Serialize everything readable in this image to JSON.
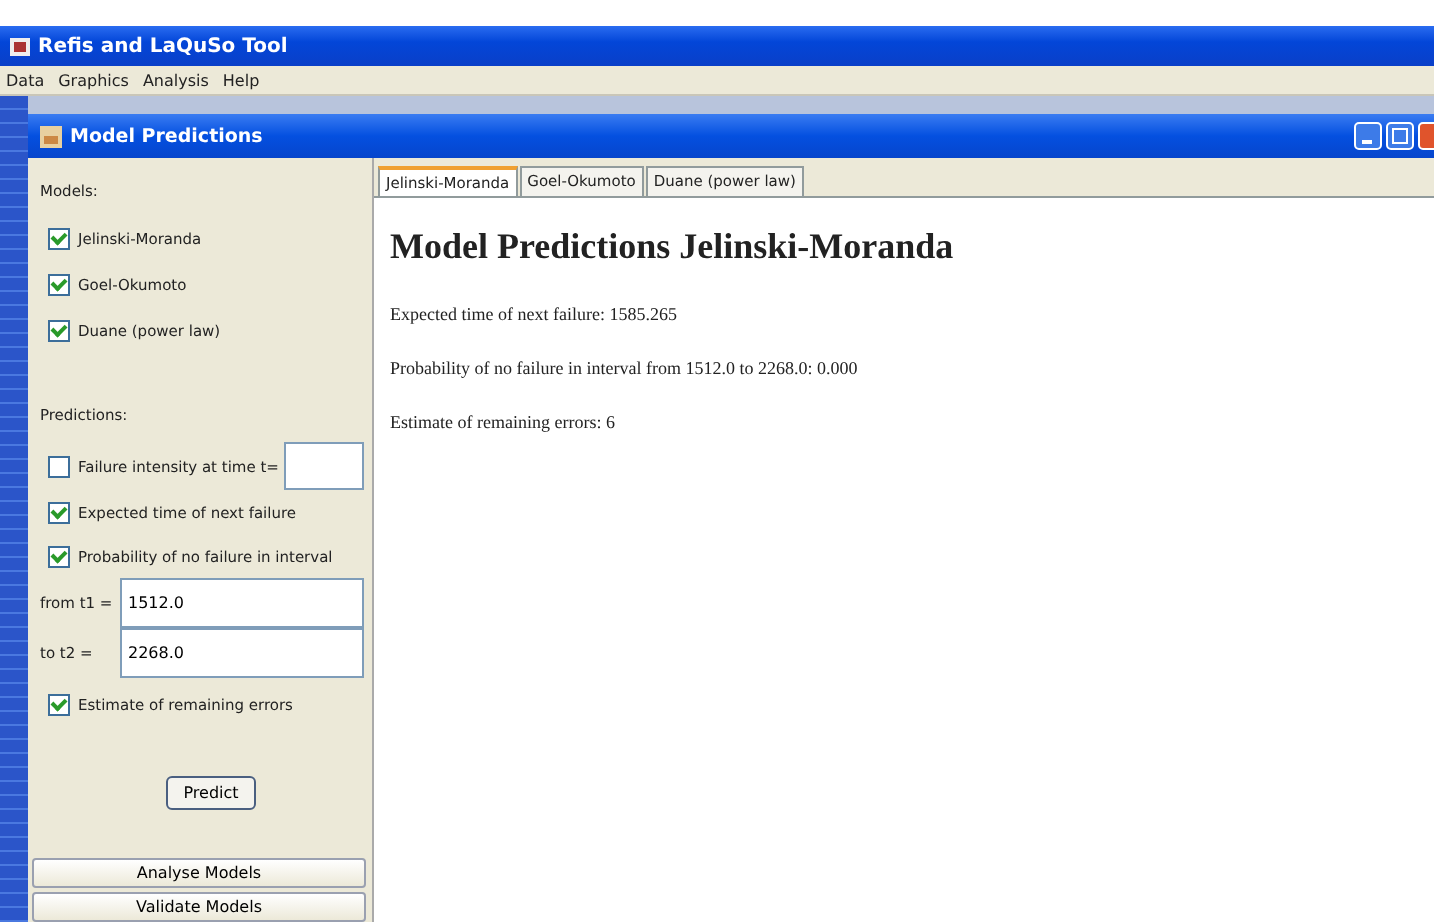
{
  "app_window": {
    "title": "Refis and LaQuSo Tool"
  },
  "menu": [
    "Data",
    "Graphics",
    "Analysis",
    "Help"
  ],
  "dialog": {
    "title": "Model Predictions"
  },
  "models": {
    "label": "Models:",
    "items": [
      {
        "label": "Jelinski-Moranda",
        "checked": true
      },
      {
        "label": "Goel-Okumoto",
        "checked": true
      },
      {
        "label": "Duane (power law)",
        "checked": true
      }
    ]
  },
  "predictions": {
    "label": "Predictions:",
    "failure_intensity": {
      "label": "Failure intensity at time t=",
      "checked": false
    },
    "next_failure": {
      "label": "Expected time of next failure",
      "checked": true
    },
    "no_failure": {
      "label": "Probability of no failure in interval",
      "checked": true
    },
    "from": {
      "label": "from t1 =",
      "value": "1512.0"
    },
    "to": {
      "label": "to t2 =",
      "value": "2268.0"
    },
    "remaining": {
      "label": "Estimate of remaining errors",
      "checked": true
    }
  },
  "predict_button": "Predict",
  "bottom_buttons": [
    "Analyse Models",
    "Validate Models"
  ],
  "tabs": [
    {
      "label": "Jelinski-Moranda",
      "selected": true
    },
    {
      "label": "Goel-Okumoto",
      "selected": false
    },
    {
      "label": "Duane (power law)",
      "selected": false
    }
  ],
  "result": {
    "heading": "Model Predictions Jelinski-Moranda",
    "lines": [
      "Expected time of next failure: 1585.265",
      "Probability of no failure in interval from 1512.0 to 2268.0: 0.000",
      "Estimate of remaining errors: 6"
    ]
  }
}
